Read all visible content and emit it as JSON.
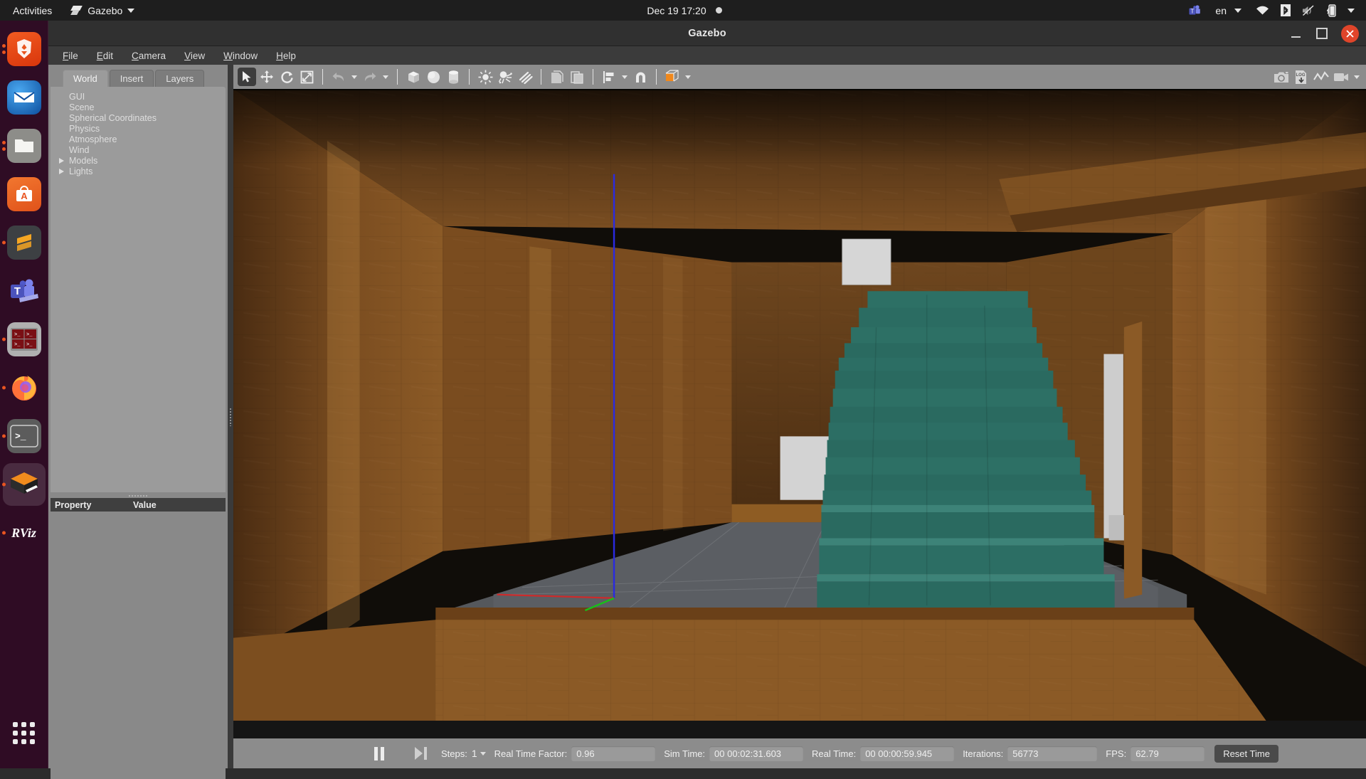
{
  "topbar": {
    "activities": "Activities",
    "app_menu": {
      "label": "Gazebo",
      "icon": "gazebo-app-icon"
    },
    "clock": "Dec 19  17:20",
    "recording_indicator": "recording-dot-icon",
    "tray": [
      {
        "name": "teams-icon",
        "glyph": "T"
      },
      {
        "name": "keyboard-layout",
        "label": "en"
      },
      {
        "name": "wifi-icon"
      },
      {
        "name": "bluetooth-icon"
      },
      {
        "name": "volume-muted-icon"
      },
      {
        "name": "battery-charging-icon"
      },
      {
        "name": "system-menu-caret"
      }
    ]
  },
  "dock": {
    "items": [
      {
        "name": "brave-browser",
        "label": "Brave",
        "glyph": "⬤",
        "bg": "#e8551f",
        "running": true
      },
      {
        "name": "thunderbird",
        "label": "Thunderbird",
        "glyph": "✉",
        "bg": "#1a4a8a",
        "running": false
      },
      {
        "name": "files",
        "label": "Files",
        "glyph": "▭",
        "bg": "#9b9b9b",
        "running": true
      },
      {
        "name": "ubuntu-software",
        "label": "Ubuntu Software",
        "glyph": "A",
        "bg": "#e95420",
        "running": false
      },
      {
        "name": "sublime-text",
        "label": "Sublime Text",
        "glyph": "S",
        "bg": "#3c3f41",
        "running": true
      },
      {
        "name": "microsoft-teams",
        "label": "Microsoft Teams",
        "glyph": "T",
        "bg": "#5059c9",
        "running": false
      },
      {
        "name": "terminator",
        "label": "Terminator",
        "glyph": ">_",
        "bg": "#8b0f1e",
        "running": true
      },
      {
        "name": "firefox",
        "label": "Firefox",
        "glyph": "●",
        "bg": "#ff7139",
        "running": true
      },
      {
        "name": "terminal",
        "label": "Terminal",
        "glyph": ">_",
        "bg": "#5a5a5a",
        "running": true
      },
      {
        "name": "gazebo",
        "label": "Gazebo",
        "glyph": "◆",
        "bg": "#f08b1d",
        "running": true,
        "active": true
      },
      {
        "name": "rviz",
        "label": "RViz",
        "glyph": "RViz",
        "bg": "transparent",
        "running": true
      }
    ],
    "show_applications": "show-applications-grid"
  },
  "window": {
    "title": "Gazebo",
    "controls": {
      "minimize": "–",
      "maximize": "□",
      "close": "✕"
    }
  },
  "menubar": [
    {
      "name": "menu-file",
      "label": "File",
      "mnemonic": "F"
    },
    {
      "name": "menu-edit",
      "label": "Edit",
      "mnemonic": "E"
    },
    {
      "name": "menu-camera",
      "label": "Camera",
      "mnemonic": "C"
    },
    {
      "name": "menu-view",
      "label": "View",
      "mnemonic": "V"
    },
    {
      "name": "menu-window",
      "label": "Window",
      "mnemonic": "W"
    },
    {
      "name": "menu-help",
      "label": "Help",
      "mnemonic": "H"
    }
  ],
  "left_panel": {
    "tabs": [
      {
        "name": "tab-world",
        "label": "World",
        "active": true
      },
      {
        "name": "tab-insert",
        "label": "Insert",
        "active": false
      },
      {
        "name": "tab-layers",
        "label": "Layers",
        "active": false
      }
    ],
    "tree": [
      {
        "label": "GUI",
        "expandable": false
      },
      {
        "label": "Scene",
        "expandable": false
      },
      {
        "label": "Spherical Coordinates",
        "expandable": false
      },
      {
        "label": "Physics",
        "expandable": false
      },
      {
        "label": "Atmosphere",
        "expandable": false
      },
      {
        "label": "Wind",
        "expandable": false
      },
      {
        "label": "Models",
        "expandable": true
      },
      {
        "label": "Lights",
        "expandable": true
      }
    ],
    "property_table": {
      "columns": [
        "Property",
        "Value"
      ],
      "rows": []
    }
  },
  "toolbar": {
    "left": [
      {
        "name": "select-mode-button",
        "icon": "cursor-arrow-icon",
        "active": true
      },
      {
        "name": "translate-mode-button",
        "icon": "move-arrows-icon",
        "active": false
      },
      {
        "name": "rotate-mode-button",
        "icon": "rotate-icon",
        "active": false
      },
      {
        "name": "scale-mode-button",
        "icon": "scale-icon",
        "active": false
      },
      {
        "name": "undo-button",
        "icon": "undo-arrow-icon",
        "has_caret": true
      },
      {
        "name": "redo-button",
        "icon": "redo-arrow-icon",
        "has_caret": true
      },
      {
        "name": "insert-box-button",
        "icon": "box-icon"
      },
      {
        "name": "insert-sphere-button",
        "icon": "sphere-icon"
      },
      {
        "name": "insert-cylinder-button",
        "icon": "cylinder-icon"
      },
      {
        "name": "point-light-button",
        "icon": "point-light-icon"
      },
      {
        "name": "spot-light-button",
        "icon": "spot-light-icon"
      },
      {
        "name": "directional-light-button",
        "icon": "directional-light-icon"
      },
      {
        "name": "copy-button",
        "icon": "copy-icon"
      },
      {
        "name": "paste-button",
        "icon": "paste-icon"
      },
      {
        "name": "align-button",
        "icon": "align-icon",
        "has_caret": true
      },
      {
        "name": "snap-button",
        "icon": "magnet-snap-icon"
      },
      {
        "name": "view-mode-button",
        "icon": "orange-cube-icon",
        "has_caret": true
      }
    ],
    "right": [
      {
        "name": "screenshot-button",
        "icon": "camera-icon"
      },
      {
        "name": "save-log-button",
        "icon": "log-download-icon"
      },
      {
        "name": "plot-button",
        "icon": "plot-line-icon"
      },
      {
        "name": "record-video-button",
        "icon": "video-camera-icon",
        "has_caret": true
      }
    ]
  },
  "statusbar": {
    "pause_button": "pause-icon",
    "step_button": "step-forward-icon",
    "steps_label": "Steps:",
    "steps_value": "1",
    "real_time_factor_label": "Real Time Factor:",
    "real_time_factor_value": "0.96",
    "sim_time_label": "Sim Time:",
    "sim_time_value": "00 00:02:31.603",
    "real_time_label": "Real Time:",
    "real_time_value": "00 00:00:59.945",
    "iterations_label": "Iterations:",
    "iterations_value": "56773",
    "fps_label": "FPS:",
    "fps_value": "62.79",
    "reset_time_label": "Reset Time"
  },
  "viewport": {
    "description": "Gazebo 3D render view: wooden corridor interior with a teal pyramid staircase model",
    "colors": {
      "wood_wall": "#6b4420",
      "wood_floor_far": "#8a5a28",
      "ground_plane": "#55585c",
      "stairs_teal": "#2a6b60",
      "stairs_teal_light": "#3d8378",
      "white_panel": "#d6d6d6",
      "axis_x": "#cc2b2b",
      "axis_y": "#18c018",
      "axis_z": "#2a2ae0",
      "background": "#111111"
    }
  }
}
